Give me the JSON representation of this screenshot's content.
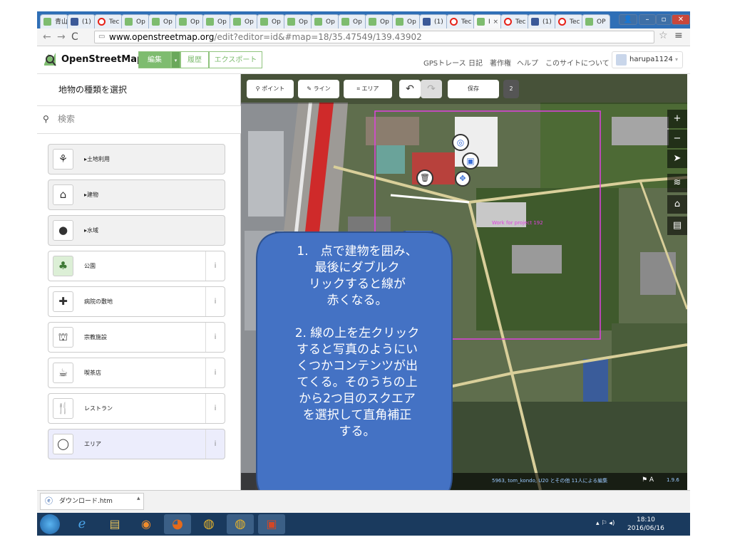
{
  "browser": {
    "tabs": [
      {
        "label": "青山",
        "icon": "document-icon"
      },
      {
        "label": "(1)",
        "icon": "facebook-icon"
      },
      {
        "label": "Tec",
        "icon": "ted-icon"
      },
      {
        "label": "Op",
        "icon": "osm-icon"
      },
      {
        "label": "Op",
        "icon": "osm-icon"
      },
      {
        "label": "Op",
        "icon": "osm-icon"
      },
      {
        "label": "Op",
        "icon": "osm-icon"
      },
      {
        "label": "Op",
        "icon": "osm-icon"
      },
      {
        "label": "Op",
        "icon": "osm-icon"
      },
      {
        "label": "Op",
        "icon": "osm-icon"
      },
      {
        "label": "Op",
        "icon": "osm-icon"
      },
      {
        "label": "Op",
        "icon": "osm-icon"
      },
      {
        "label": "Op",
        "icon": "osm-icon"
      },
      {
        "label": "Op",
        "icon": "osm-icon"
      },
      {
        "label": "(1)",
        "icon": "facebook-icon"
      },
      {
        "label": "Tec",
        "icon": "ted-icon"
      },
      {
        "label": "Ӏ",
        "icon": "osm-icon"
      },
      {
        "label": "Tec",
        "icon": "ted-icon"
      },
      {
        "label": "(1)",
        "icon": "facebook-icon"
      },
      {
        "label": "Tec",
        "icon": "ted-icon"
      },
      {
        "label": "OP",
        "icon": "osm-icon"
      }
    ],
    "url_host": "www.openstreetmap.org",
    "url_rest": "/edit?editor=id&#map=18/35.47549/139.43902"
  },
  "osm": {
    "site_name": "OpenStreetMap",
    "edit_label": "編集",
    "history_label": "履歴",
    "export_label": "エクスポート",
    "nav_links": [
      "GPSトレース",
      "日記",
      "著作権",
      "ヘルプ",
      "このサイトについて"
    ],
    "username": "harupa1124"
  },
  "sidebar": {
    "title": "地物の種類を選択",
    "search_placeholder": "検索",
    "presets": [
      {
        "label": "▸土地利用",
        "icon": "landuse-icon",
        "glyph": "⚘",
        "kind": "category"
      },
      {
        "label": "▸建物",
        "icon": "building-icon",
        "glyph": "⌂",
        "kind": "category"
      },
      {
        "label": "▸水域",
        "icon": "water-icon",
        "glyph": "●",
        "kind": "category"
      },
      {
        "label": "公園",
        "icon": "tree-icon",
        "glyph": "♣",
        "kind": "preset",
        "info": "i"
      },
      {
        "label": "病院の敷地",
        "icon": "hospital-icon",
        "glyph": "✚",
        "kind": "preset",
        "info": "i"
      },
      {
        "label": "宗教施設",
        "icon": "religious-icon",
        "glyph": "⛫",
        "kind": "preset",
        "info": "i"
      },
      {
        "label": "喫茶店",
        "icon": "cafe-icon",
        "glyph": "☕",
        "kind": "preset",
        "info": "i"
      },
      {
        "label": "レストラン",
        "icon": "restaurant-icon",
        "glyph": "🍴",
        "kind": "preset",
        "info": "i"
      },
      {
        "label": "エリア",
        "icon": "area-icon",
        "glyph": "◯",
        "kind": "selected",
        "info": "i"
      }
    ]
  },
  "map_toolbar": {
    "point": "ポイント",
    "line": "ライン",
    "area": "エリア",
    "save": "保存",
    "save_count": "2"
  },
  "map": {
    "label": "Work for project 192",
    "attribution": "5963, tom_kondo, U20 とその他 11人による編集",
    "zoom_readout": "1.9.6"
  },
  "callout": {
    "text": "1.　点で建物を囲み、\n最後にダブルク\nリックすると線が\n赤くなる。\n\n2. 線の上を左クリック\nすると写真のようにい\nくつかコンテンツが出\nてくる。そのうちの上\nから2つ目のスクエア\nを選択して直角補正\nする。"
  },
  "download_bar": {
    "file": "ダウンロード.htm"
  },
  "taskbar": {
    "time": "18:10",
    "date": "2016/06/16"
  },
  "colors": {
    "osm_green": "#7ebc6f",
    "callout_blue": "#4472c4",
    "selection_magenta": "#e040e0"
  }
}
